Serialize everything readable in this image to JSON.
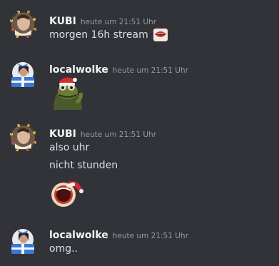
{
  "messages": [
    {
      "author": "KUBI",
      "timestamp": "heute um 21:51 Uhr",
      "lines": [
        "morgen 16h stream"
      ],
      "avatar": "kubi-christmas-avatar",
      "inline_emoji": "mouth-emoji"
    },
    {
      "author": "localwolke",
      "timestamp": "heute um 21:51 Uhr",
      "lines": [],
      "avatar": "localwolke-gift-avatar",
      "sticker": "kermit-santa-hat-emoji"
    },
    {
      "author": "KUBI",
      "timestamp": "heute um 21:51 Uhr",
      "lines": [
        "also uhr",
        "nicht stunden"
      ],
      "avatar": "kubi-christmas-avatar",
      "sticker": "santa-hat-mouth-emoji"
    },
    {
      "author": "localwolke",
      "timestamp": "heute um 21:51 Uhr",
      "lines": [
        "omg.."
      ],
      "avatar": "localwolke-gift-avatar"
    }
  ],
  "colors": {
    "background": "#313338",
    "username": "#f2f3f5",
    "text": "#dbdee1",
    "timestamp": "#949ba4"
  }
}
